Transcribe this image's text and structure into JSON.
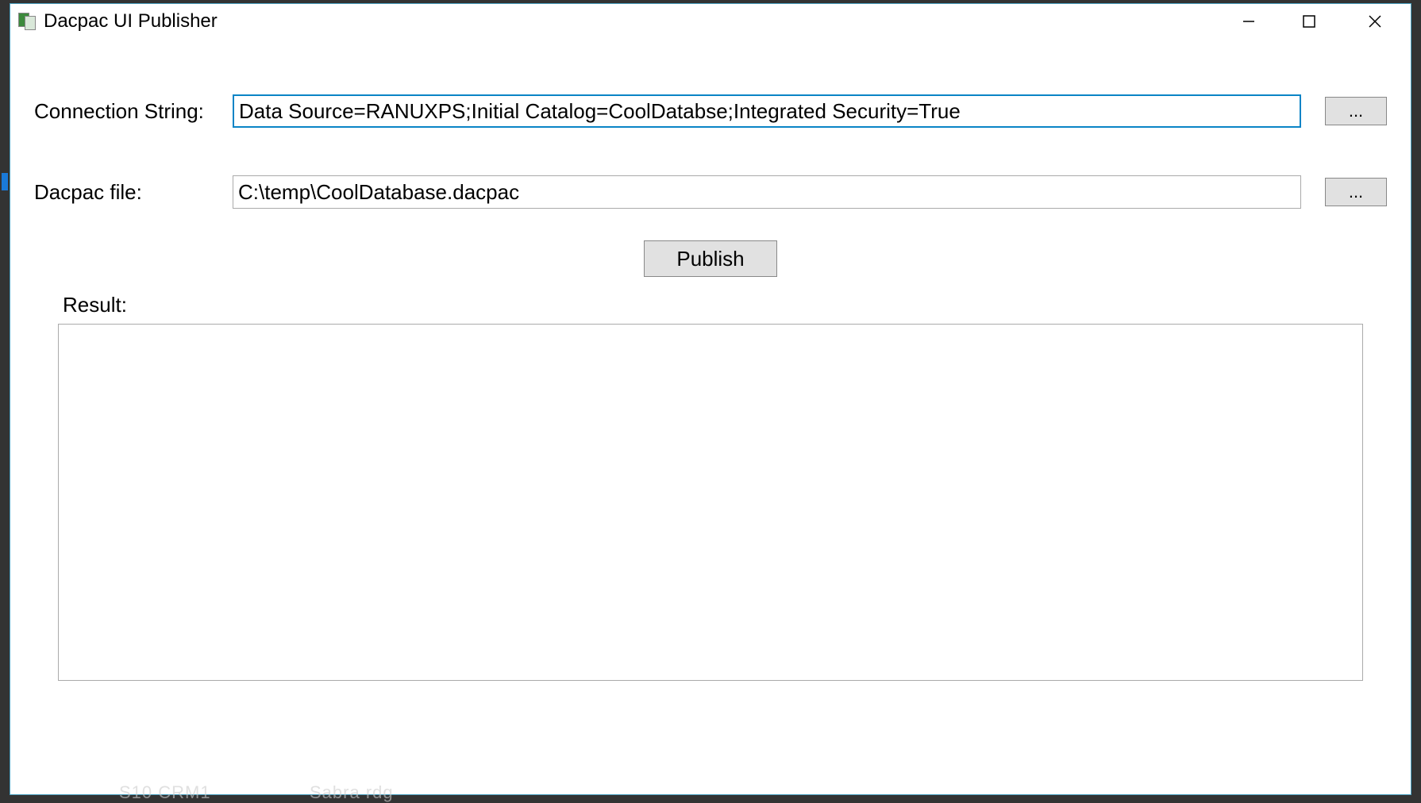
{
  "window": {
    "title": "Dacpac UI Publisher"
  },
  "form": {
    "connection_label": "Connection String:",
    "connection_value": "Data Source=RANUXPS;Initial Catalog=CoolDatabse;Integrated Security=True",
    "connection_browse": "...",
    "dacpac_label": "Dacpac file:",
    "dacpac_value": "C:\\temp\\CoolDatabase.dacpac",
    "dacpac_browse": "...",
    "publish_label": "Publish",
    "result_label": "Result:",
    "result_value": ""
  },
  "taskbar": {
    "hint1": "S10  CRM1",
    "hint2": "Sabra rdg"
  }
}
